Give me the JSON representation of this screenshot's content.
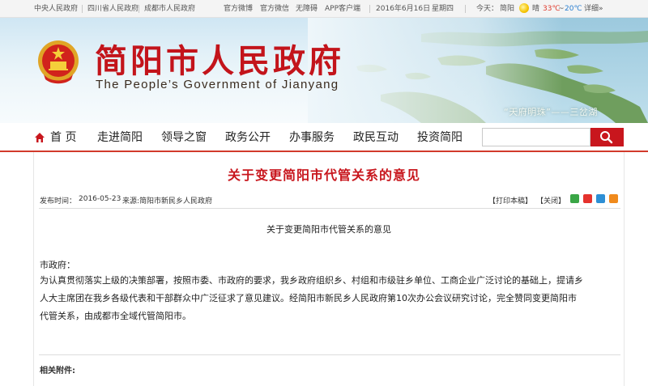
{
  "topbar": {
    "links": [
      "中央人民政府",
      "四川省人民政府",
      "成都市人民政府"
    ],
    "services": [
      "官方微博",
      "官方微信",
      "无障碍",
      "APP客户端"
    ],
    "date": "2016年6月16日",
    "weekday": "星期四",
    "weather_label": "今天：",
    "city": "简阳",
    "condition": "晴",
    "temp_high": "33℃",
    "temp_sep": "~",
    "temp_low": "20℃",
    "detail_link": "详细»"
  },
  "banner": {
    "title_cn": "简阳市人民政府",
    "title_en": "The People’s Government of Jianyang",
    "slogan": "“天府明珠”——三岔湖"
  },
  "nav": {
    "items": [
      "首 页",
      "走进简阳",
      "领导之窗",
      "政务公开",
      "办事服务",
      "政民互动",
      "投资简阳"
    ],
    "search_value": ""
  },
  "article": {
    "title": "关于变更简阳市代管关系的意见",
    "meta_publish_label": "发布时间：",
    "meta_date": "2016-05-23",
    "meta_source": "来源:简阳市新民乡人民政府",
    "print_label": "【打印本稿】",
    "close_label": "【关闭】",
    "sub_title": "关于变更简阳市代管关系的意见",
    "salutation": "市政府：",
    "body_lines": [
      "为认真贯彻落实上级的决策部署，按照市委、市政府的要求，我乡政府组织乡、村组和市级驻乡单位、工商企业广泛讨论的基础上，提请乡",
      "人大主席团在我乡各级代表和干部群众中广泛征求了意见建议。经简阳市新民乡人民政府第10次办公会议研究讨论，完全赞同变更简阳市",
      "代管关系，由成都市全域代管简阳市。"
    ],
    "attachment_label": "相关附件:"
  },
  "colors": {
    "brand_red": "#c8161d",
    "nav_rule": "#d23a2b"
  }
}
